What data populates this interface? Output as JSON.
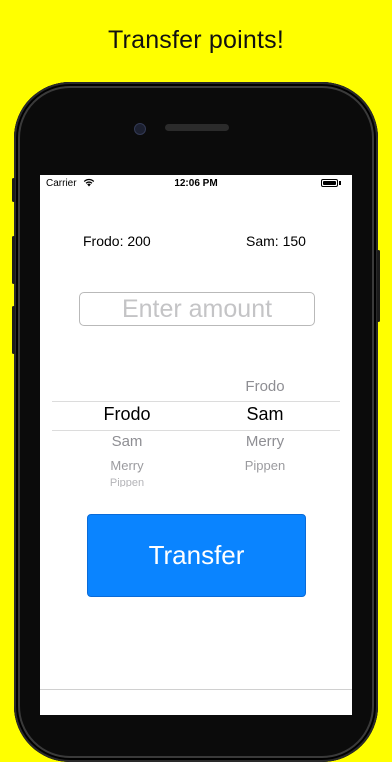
{
  "headline": "Transfer points!",
  "status_bar": {
    "carrier": "Carrier",
    "time": "12:06 PM"
  },
  "scores": {
    "left": "Frodo: 200",
    "right": "Sam: 150"
  },
  "amount_input": {
    "placeholder": "Enter amount",
    "value": ""
  },
  "picker": {
    "from": {
      "selected": "Frodo",
      "below": [
        "Sam",
        "Merry",
        "Pippen"
      ]
    },
    "to": {
      "above": [
        "Frodo"
      ],
      "selected": "Sam",
      "below": [
        "Merry",
        "Pippen"
      ]
    }
  },
  "transfer_button": {
    "label": "Transfer"
  },
  "colors": {
    "page_background": "#ffff00",
    "button": "#0a84ff"
  }
}
